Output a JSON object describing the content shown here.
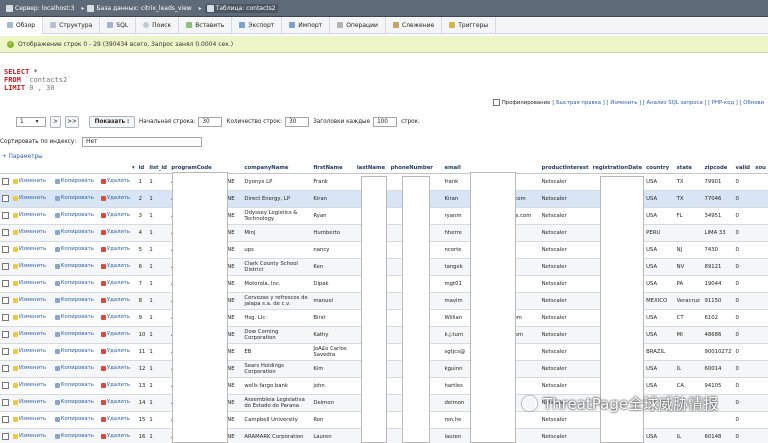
{
  "breadcrumb": [
    "Сервер: localhost:3",
    "База данных: citrix_leads_view",
    "Таблица: contacts2"
  ],
  "tabs": [
    "Обзор",
    "Структура",
    "SQL",
    "Поиск",
    "Вставить",
    "Экспорт",
    "Импорт",
    "Операции",
    "Слежение",
    "Триггеры"
  ],
  "success_message": "Отображение строк 0 - 29 (390434 всего, Запрос занял 0.0004 сек.)",
  "sql": {
    "select": "SELECT",
    "star": " *",
    "from": "FROM",
    "table": " `contacts2`",
    "limit": "LIMIT",
    "limit_values": " 0 , 30"
  },
  "sql_options": {
    "profiling": "Профилирование",
    "links": "[ Быстрая правка ] [ Изменить ] [ Анализ SQL запроса ] [ PHP-код ] [ Обнови"
  },
  "navigation": {
    "page": "1",
    "first": ">",
    "last": ">>",
    "show": "Показать :",
    "start_label": "Начальная строка:",
    "start_value": "30",
    "count_label": "Количество строк:",
    "count_value": "30",
    "headers_label": "Заголовки каждые",
    "headers_value": "100",
    "rows_suffix": "строк."
  },
  "sort": {
    "label": "Сортировать по индексу:",
    "value": "Нет"
  },
  "params_label": "+ Параметры",
  "table": {
    "actions": {
      "edit": "Изменить",
      "copy": "Копировать",
      "delete": "Удалить"
    },
    "columns": [
      "",
      "",
      "",
      "",
      "id",
      "list_id",
      "programCode",
      "companyName",
      "firstName",
      "lastName",
      "phoneNumber",
      "email",
      "productInterest",
      "registrationDate",
      "country",
      "state",
      "zipcode",
      "valid",
      "sou"
    ],
    "rows": [
      {
        "id": "1",
        "list": "1",
        "program": "AMW",
        "program_tail": "LINE",
        "company": "Dyonyx LP",
        "first": "Frank",
        "last": "",
        "phone": "",
        "email": "frank",
        "email2": "",
        "product": "Netscaler",
        "reg": "",
        "country": "USA",
        "state": "TX",
        "zip": "79901",
        "valid": "0"
      },
      {
        "id": "2",
        "list": "1",
        "program": "AMW",
        "program_tail": "LINE",
        "company": "Direct Energy, LP",
        "first": "Kiran",
        "last": "",
        "phone": "",
        "email": "Kiran",
        "email2": "nergy.com",
        "product": "Netscaler",
        "reg": "",
        "country": "USA",
        "state": "TX",
        "zip": "77046",
        "valid": "0"
      },
      {
        "id": "3",
        "list": "1",
        "program": "AMW",
        "program_tail": "LINE",
        "company": "Odyssey Logistics & Technology",
        "first": "Ryan",
        "last": "",
        "phone": "7",
        "email": "ryanm",
        "email2": "gistics.com",
        "product": "Netscaler",
        "reg": "",
        "country": "USA",
        "state": "FL",
        "zip": "34951",
        "valid": "0"
      },
      {
        "id": "4",
        "list": "1",
        "program": "AMW",
        "program_tail": "LINE",
        "company": "Minj",
        "first": "Humberto",
        "last": "",
        "phone": "",
        "email": "hherre",
        "email2": "pe",
        "product": "Netscaler",
        "reg": "",
        "country": "PERU",
        "state": "",
        "zip": "LIMA 33",
        "valid": "0"
      },
      {
        "id": "5",
        "list": "1",
        "program": "AMW",
        "program_tail": "LINE",
        "company": "ups",
        "first": "nancy",
        "last": "",
        "phone": "",
        "email": "ncorte",
        "email2": "",
        "product": "Netscaler",
        "reg": "",
        "country": "USA",
        "state": "NJ",
        "zip": "7430",
        "valid": "0"
      },
      {
        "id": "6",
        "list": "1",
        "program": "AMW",
        "program_tail": "LINE",
        "company": "Clark County School District",
        "first": "Ken",
        "last": "",
        "phone": "7",
        "email": "tangek",
        "email2": "nst",
        "product": "Netscaler",
        "reg": "",
        "country": "USA",
        "state": "NV",
        "zip": "89121",
        "valid": "0"
      },
      {
        "id": "7",
        "list": "1",
        "program": "AMW",
        "program_tail": "LINE",
        "company": "Motorola, Inc.",
        "first": "Dipak",
        "last": "",
        "phone": "",
        "email": "mgt01",
        "email2": "m",
        "product": "Netscaler",
        "reg": "",
        "country": "USA",
        "state": "PA",
        "zip": "19044",
        "valid": "0"
      },
      {
        "id": "8",
        "list": "1",
        "program": "AMW",
        "program_tail": "LINE",
        "company": "Cervezas y refrescos de jalapa s.a. de c.v.",
        "first": "manuel",
        "last": "",
        "phone": "09-",
        "email": "mavim",
        "email2": "",
        "product": "Netscaler",
        "reg": "",
        "country": "MEXICO",
        "state": "Veracruz",
        "zip": "91150",
        "valid": "0"
      },
      {
        "id": "9",
        "list": "1",
        "program": "AMW",
        "program_tail": "LINE",
        "company": "Hsg. Llc",
        "first": "Birst",
        "last": "",
        "phone": "",
        "email": "Willian",
        "email2": "nb.com",
        "product": "Netscaler",
        "reg": "",
        "country": "USA",
        "state": "CT",
        "zip": "6102",
        "valid": "0"
      },
      {
        "id": "10",
        "list": "1",
        "program": "AMW",
        "program_tail": "LINE",
        "company": "Dow Corning Corporation",
        "first": "Kathy",
        "last": "",
        "phone": "",
        "email": "k.j.turn",
        "email2": "ng.com",
        "product": "Netscaler",
        "reg": "",
        "country": "USA",
        "state": "MI",
        "zip": "48686",
        "valid": "0"
      },
      {
        "id": "11",
        "list": "1",
        "program": "AMW",
        "program_tail": "LINE",
        "company": "EB",
        "first": "JoA£o Carlos Savedra",
        "last": "",
        "phone": "08-",
        "email": "sgtjcs@",
        "email2": "",
        "product": "Netscaler",
        "reg": "",
        "country": "BRAZIL",
        "state": "",
        "zip": "90010272",
        "valid": "0"
      },
      {
        "id": "12",
        "list": "1",
        "program": "AMW",
        "program_tail": "LINE",
        "company": "Sears Holdings Corporation",
        "first": "Kim",
        "last": "",
        "phone": "",
        "email": "kguinn",
        "email2": "",
        "product": "Netscaler",
        "reg": "",
        "country": "USA",
        "state": "IL",
        "zip": "60014",
        "valid": "0"
      },
      {
        "id": "13",
        "list": "1",
        "program": "AMW",
        "program_tail": "LINE",
        "company": "wells fargo bank",
        "first": "john",
        "last": "",
        "phone": "",
        "email": "hartles",
        "email2": "",
        "product": "Netscaler",
        "reg": "",
        "country": "USA",
        "state": "CA",
        "zip": "94105",
        "valid": "0"
      },
      {
        "id": "14",
        "list": "1",
        "program": "AMW",
        "program_tail": "LINE",
        "company": "Assembleia Legislativa do Estado do Parana",
        "first": "Deimon",
        "last": "",
        "phone": "05-",
        "email": "deimon",
        "email2": "",
        "product": "Netscaler",
        "reg": "",
        "country": "",
        "state": "",
        "zip": "",
        "valid": "0"
      },
      {
        "id": "15",
        "list": "1",
        "program": "AMW",
        "program_tail": "LINE",
        "company": "Campbell University",
        "first": "Ron",
        "last": "",
        "phone": "",
        "email": "ron.he",
        "email2": "",
        "product": "Netscaler",
        "reg": "",
        "country": "",
        "state": "",
        "zip": "",
        "valid": "0"
      },
      {
        "id": "16",
        "list": "1",
        "program": "AMW",
        "program_tail": "LINE",
        "company": "ARAMARK Corporation",
        "first": "Lauren",
        "last": "",
        "phone": "",
        "email": "lauren",
        "email2": "net",
        "product": "Netscaler",
        "reg": "",
        "country": "USA",
        "state": "IL",
        "zip": "60148",
        "valid": "0"
      }
    ]
  },
  "watermark": "ThreatPage全球威胁情报"
}
